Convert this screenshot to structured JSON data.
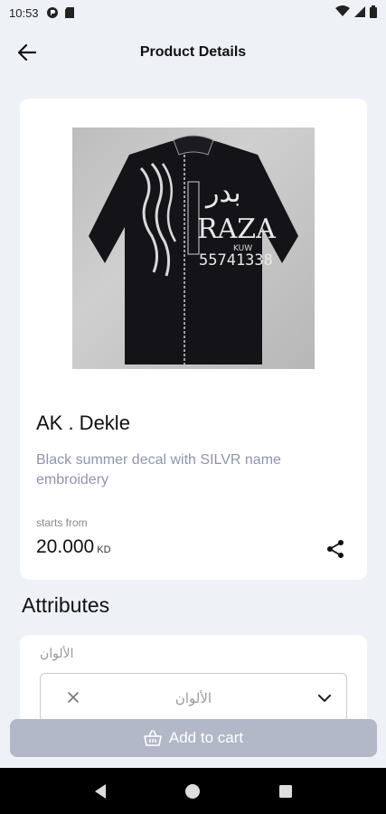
{
  "status_bar": {
    "time": "10:53",
    "icons": [
      "app-notification-icon",
      "sd-card-icon",
      "wifi-icon",
      "cellular-signal-icon",
      "battery-icon"
    ]
  },
  "header": {
    "title": "Product Details",
    "back_icon": "arrow-left-icon"
  },
  "product": {
    "name": "AK . Dekle",
    "description": "Black summer decal with SILVR name embroidery",
    "price_label": "starts from",
    "price": "20.000",
    "currency": "KD",
    "share_icon": "share-icon",
    "image": {
      "watermark_arabic": "بدر",
      "watermark_brand": "RAZA",
      "watermark_small": "KUW",
      "watermark_phone": "55741338"
    }
  },
  "attributes": {
    "title": "Attributes",
    "field_label": "الألوان",
    "select_placeholder": "الألوان",
    "clear_icon": "close-icon",
    "chevron_icon": "chevron-down-icon"
  },
  "cart": {
    "label": "Add to cart",
    "icon": "basket-icon"
  },
  "nav": {
    "icons": [
      "back-triangle-icon",
      "home-circle-icon",
      "recents-square-icon"
    ]
  },
  "colors": {
    "background": "#eef1f6",
    "card": "#ffffff",
    "description_text": "#8f94b0",
    "cart_button": "#b3b8c8",
    "nav_bar": "#000000"
  }
}
